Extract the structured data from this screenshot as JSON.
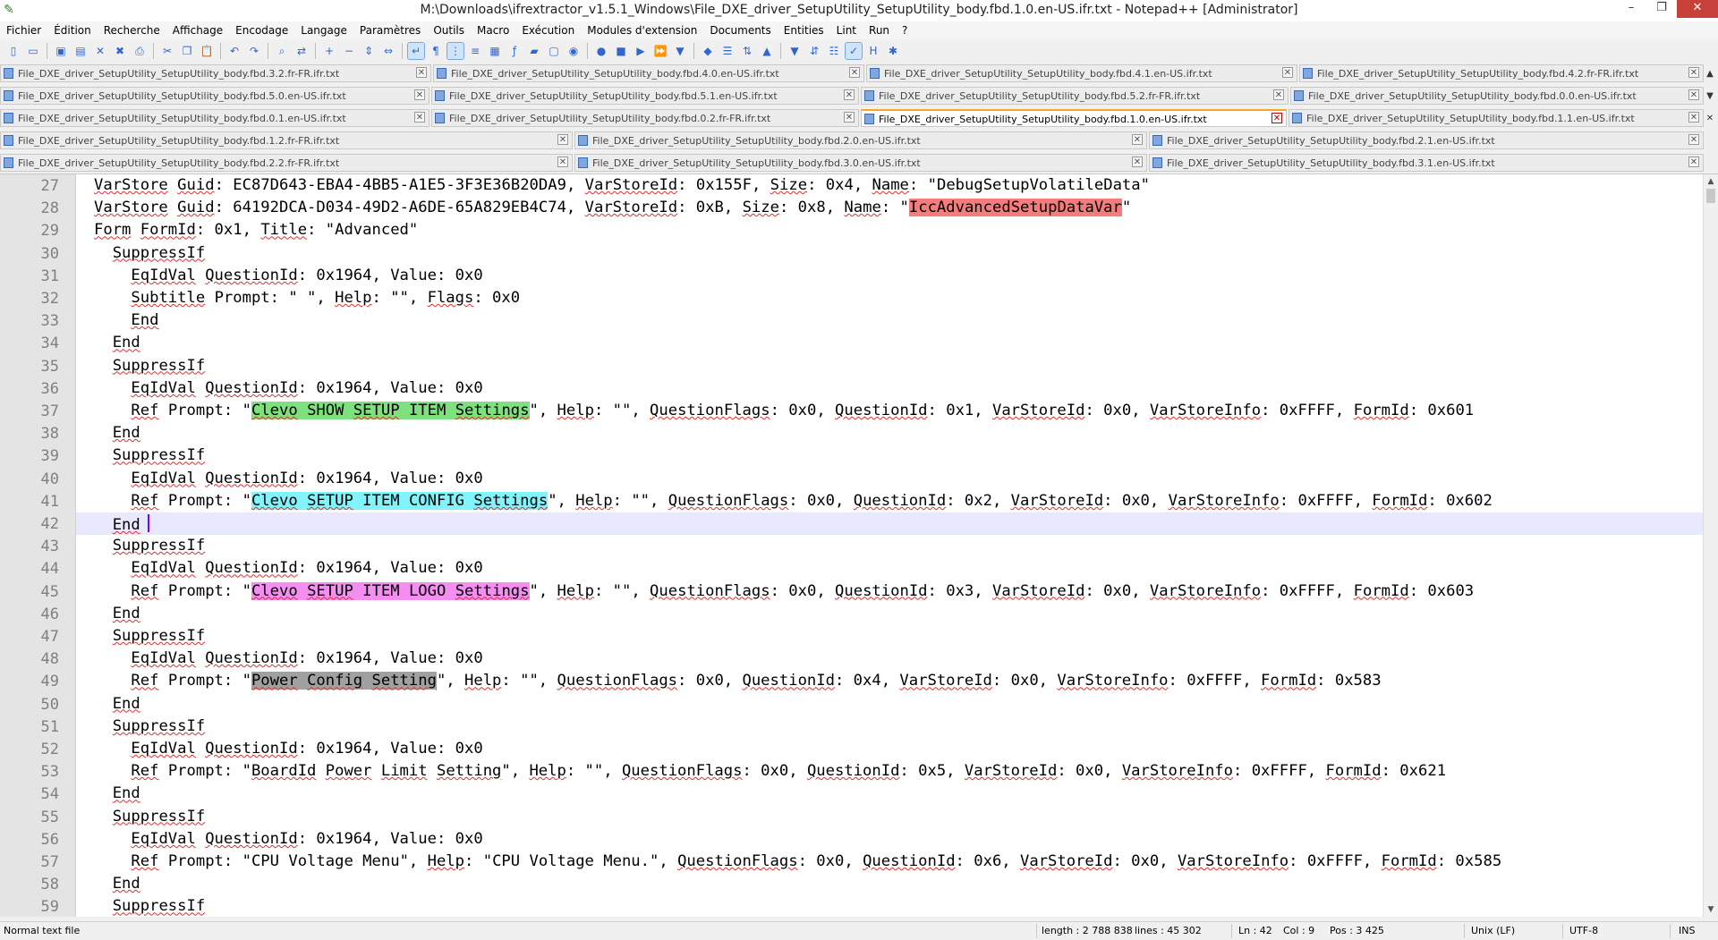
{
  "window": {
    "title": "M:\\Downloads\\ifrextractor_v1.5.1_Windows\\File_DXE_driver_SetupUtility_SetupUtility_body.fbd.1.0.en-US.ifr.txt - Notepad++ [Administrator]",
    "minimize": "–",
    "maximize": "❐",
    "close": "✕"
  },
  "menu": [
    "Fichier",
    "Édition",
    "Recherche",
    "Affichage",
    "Encodage",
    "Langage",
    "Paramètres",
    "Outils",
    "Macro",
    "Exécution",
    "Modules d'extension",
    "Documents",
    "Entities",
    "Lint",
    "Run",
    "?"
  ],
  "toolbar_icons": [
    "new-file-icon",
    "open-file-icon",
    "save-icon",
    "save-all-icon",
    "close-icon",
    "close-all-icon",
    "print-icon",
    "cut-icon",
    "copy-icon",
    "paste-icon",
    "undo-icon",
    "redo-icon",
    "find-icon",
    "replace-icon",
    "zoom-in-icon",
    "zoom-out-icon",
    "sync-v-icon",
    "sync-h-icon",
    "word-wrap-icon",
    "show-all-chars-icon",
    "indent-guide-icon",
    "lang-icon",
    "doc-map-icon",
    "function-list-icon",
    "folder-icon",
    "monitor-icon",
    "eye-icon",
    "record-icon",
    "stop-icon",
    "play-icon",
    "play-multi-icon",
    "save-macro-icon",
    "plugin-icon",
    "list-icon",
    "compare-icon",
    "up-icon",
    "down-icon",
    "compare-last-icon",
    "clear-icon",
    "spell-check-icon",
    "hex-icon",
    "settings-icon"
  ],
  "tabs": {
    "row1": [
      {
        "label": "File_DXE_driver_SetupUtility_SetupUtility_body.fbd.3.2.fr-FR.ifr.txt",
        "active": false
      },
      {
        "label": "File_DXE_driver_SetupUtility_SetupUtility_body.fbd.4.0.en-US.ifr.txt",
        "active": false
      },
      {
        "label": "File_DXE_driver_SetupUtility_SetupUtility_body.fbd.4.1.en-US.ifr.txt",
        "active": false
      },
      {
        "label": "File_DXE_driver_SetupUtility_SetupUtility_body.fbd.4.2.fr-FR.ifr.txt",
        "active": false
      }
    ],
    "row2": [
      {
        "label": "File_DXE_driver_SetupUtility_SetupUtility_body.fbd.5.0.en-US.ifr.txt",
        "active": false
      },
      {
        "label": "File_DXE_driver_SetupUtility_SetupUtility_body.fbd.5.1.en-US.ifr.txt",
        "active": false
      },
      {
        "label": "File_DXE_driver_SetupUtility_SetupUtility_body.fbd.5.2.fr-FR.ifr.txt",
        "active": false
      },
      {
        "label": "File_DXE_driver_SetupUtility_SetupUtility_body.fbd.0.0.en-US.ifr.txt",
        "active": false
      }
    ],
    "row3": [
      {
        "label": "File_DXE_driver_SetupUtility_SetupUtility_body.fbd.0.1.en-US.ifr.txt",
        "active": false
      },
      {
        "label": "File_DXE_driver_SetupUtility_SetupUtility_body.fbd.0.2.fr-FR.ifr.txt",
        "active": false
      },
      {
        "label": "File_DXE_driver_SetupUtility_SetupUtility_body.fbd.1.0.en-US.ifr.txt",
        "active": true
      },
      {
        "label": "File_DXE_driver_SetupUtility_SetupUtility_body.fbd.1.1.en-US.ifr.txt",
        "active": false
      }
    ],
    "row4": [
      {
        "label": "File_DXE_driver_SetupUtility_SetupUtility_body.fbd.1.2.fr-FR.ifr.txt",
        "active": false
      },
      {
        "label": "File_DXE_driver_SetupUtility_SetupUtility_body.fbd.2.0.en-US.ifr.txt",
        "active": false
      },
      {
        "label": "File_DXE_driver_SetupUtility_SetupUtility_body.fbd.2.1.en-US.ifr.txt",
        "active": false
      }
    ],
    "row5": [
      {
        "label": "File_DXE_driver_SetupUtility_SetupUtility_body.fbd.2.2.fr-FR.ifr.txt",
        "active": false
      },
      {
        "label": "File_DXE_driver_SetupUtility_SetupUtility_body.fbd.3.0.en-US.ifr.txt",
        "active": false
      },
      {
        "label": "File_DXE_driver_SetupUtility_SetupUtility_body.fbd.3.1.en-US.ifr.txt",
        "active": false
      }
    ]
  },
  "editor": {
    "current_line": 42,
    "lines": [
      {
        "n": 27,
        "indent": 0,
        "segments": [
          {
            "t": "VarStore Guid: EC87D643-EBA4-4BB5-A1E5-3F3E36B20DA9, VarStoreId: 0x155F, Size: 0x4, Name: \"DebugSetupVolatileData\""
          }
        ]
      },
      {
        "n": 28,
        "indent": 0,
        "segments": [
          {
            "t": "VarStore Guid: 64192DCA-D034-49D2-A6DE-65A829EB4C74, VarStoreId: 0xB, Size: 0x8, Name: \""
          },
          {
            "t": "IccAdvancedSetupDataVar",
            "hl": "red"
          },
          {
            "t": "\""
          }
        ]
      },
      {
        "n": 29,
        "indent": 0,
        "segments": [
          {
            "t": "Form FormId: 0x1, Title: \"Advanced\""
          }
        ]
      },
      {
        "n": 30,
        "indent": 1,
        "segments": [
          {
            "t": "SuppressIf"
          }
        ]
      },
      {
        "n": 31,
        "indent": 2,
        "segments": [
          {
            "t": "EqIdVal QuestionId: 0x1964, Value: 0x0"
          }
        ]
      },
      {
        "n": 32,
        "indent": 2,
        "segments": [
          {
            "t": "Subtitle Prompt: \" \", Help: \"\", Flags: 0x0"
          }
        ]
      },
      {
        "n": 33,
        "indent": 2,
        "segments": [
          {
            "t": "End"
          }
        ]
      },
      {
        "n": 34,
        "indent": 1,
        "segments": [
          {
            "t": "End"
          }
        ]
      },
      {
        "n": 35,
        "indent": 1,
        "segments": [
          {
            "t": "SuppressIf"
          }
        ]
      },
      {
        "n": 36,
        "indent": 2,
        "segments": [
          {
            "t": "EqIdVal QuestionId: 0x1964, Value: 0x0"
          }
        ]
      },
      {
        "n": 37,
        "indent": 2,
        "segments": [
          {
            "t": "Ref Prompt: \""
          },
          {
            "t": "Clevo SHOW SETUP ITEM Settings",
            "hl": "green"
          },
          {
            "t": "\", Help: \"\", QuestionFlags: 0x0, QuestionId: 0x1, VarStoreId: 0x0, VarStoreInfo: 0xFFFF, FormId: 0x601"
          }
        ]
      },
      {
        "n": 38,
        "indent": 1,
        "segments": [
          {
            "t": "End"
          }
        ]
      },
      {
        "n": 39,
        "indent": 1,
        "segments": [
          {
            "t": "SuppressIf"
          }
        ]
      },
      {
        "n": 40,
        "indent": 2,
        "segments": [
          {
            "t": "EqIdVal QuestionId: 0x1964, Value: 0x0"
          }
        ]
      },
      {
        "n": 41,
        "indent": 2,
        "segments": [
          {
            "t": "Ref Prompt: \""
          },
          {
            "t": "Clevo SETUP ITEM CONFIG Settings",
            "hl": "cyan"
          },
          {
            "t": "\", Help: \"\", QuestionFlags: 0x0, QuestionId: 0x2, VarStoreId: 0x0, VarStoreInfo: 0xFFFF, FormId: 0x602"
          }
        ]
      },
      {
        "n": 42,
        "indent": 1,
        "segments": [
          {
            "t": "End"
          }
        ],
        "caret": true
      },
      {
        "n": 43,
        "indent": 1,
        "segments": [
          {
            "t": "SuppressIf"
          }
        ]
      },
      {
        "n": 44,
        "indent": 2,
        "segments": [
          {
            "t": "EqIdVal QuestionId: 0x1964, Value: 0x0"
          }
        ]
      },
      {
        "n": 45,
        "indent": 2,
        "segments": [
          {
            "t": "Ref Prompt: \""
          },
          {
            "t": "Clevo SETUP ITEM LOGO Settings",
            "hl": "pink"
          },
          {
            "t": "\", Help: \"\", QuestionFlags: 0x0, QuestionId: 0x3, VarStoreId: 0x0, VarStoreInfo: 0xFFFF, FormId: 0x603"
          }
        ]
      },
      {
        "n": 46,
        "indent": 1,
        "segments": [
          {
            "t": "End"
          }
        ]
      },
      {
        "n": 47,
        "indent": 1,
        "segments": [
          {
            "t": "SuppressIf"
          }
        ]
      },
      {
        "n": 48,
        "indent": 2,
        "segments": [
          {
            "t": "EqIdVal QuestionId: 0x1964, Value: 0x0"
          }
        ]
      },
      {
        "n": 49,
        "indent": 2,
        "segments": [
          {
            "t": "Ref Prompt: \""
          },
          {
            "t": "Power Config Setting",
            "hl": "gray"
          },
          {
            "t": "\", Help: \"\", QuestionFlags: 0x0, QuestionId: 0x4, VarStoreId: 0x0, VarStoreInfo: 0xFFFF, FormId: 0x583"
          }
        ]
      },
      {
        "n": 50,
        "indent": 1,
        "segments": [
          {
            "t": "End"
          }
        ]
      },
      {
        "n": 51,
        "indent": 1,
        "segments": [
          {
            "t": "SuppressIf"
          }
        ]
      },
      {
        "n": 52,
        "indent": 2,
        "segments": [
          {
            "t": "EqIdVal QuestionId: 0x1964, Value: 0x0"
          }
        ]
      },
      {
        "n": 53,
        "indent": 2,
        "segments": [
          {
            "t": "Ref Prompt: \"BoardId Power Limit Setting\", Help: \"\", QuestionFlags: 0x0, QuestionId: 0x5, VarStoreId: 0x0, VarStoreInfo: 0xFFFF, FormId: 0x621"
          }
        ]
      },
      {
        "n": 54,
        "indent": 1,
        "segments": [
          {
            "t": "End"
          }
        ]
      },
      {
        "n": 55,
        "indent": 1,
        "segments": [
          {
            "t": "SuppressIf"
          }
        ]
      },
      {
        "n": 56,
        "indent": 2,
        "segments": [
          {
            "t": "EqIdVal QuestionId: 0x1964, Value: 0x0"
          }
        ]
      },
      {
        "n": 57,
        "indent": 2,
        "segments": [
          {
            "t": "Ref Prompt: \"CPU Voltage Menu\", Help: \"CPU Voltage Menu.\", QuestionFlags: 0x0, QuestionId: 0x6, VarStoreId: 0x0, VarStoreInfo: 0xFFFF, FormId: 0x585"
          }
        ]
      },
      {
        "n": 58,
        "indent": 1,
        "segments": [
          {
            "t": "End"
          }
        ]
      },
      {
        "n": 59,
        "indent": 1,
        "segments": [
          {
            "t": "SuppressIf"
          }
        ]
      }
    ]
  },
  "status": {
    "file_type": "Normal text file",
    "length": "length : 2 788 838",
    "lines": "lines : 45 302",
    "ln": "Ln : 42",
    "col": "Col : 9",
    "pos": "Pos : 3 425",
    "eol": "Unix (LF)",
    "encoding": "UTF-8",
    "mode": "INS"
  }
}
